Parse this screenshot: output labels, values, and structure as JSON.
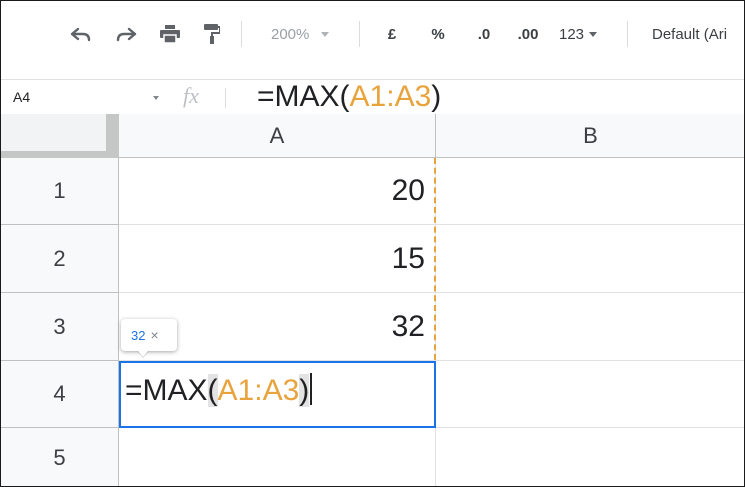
{
  "toolbar": {
    "zoom": "200%",
    "currency": "£",
    "percent": "%",
    "decrease_decimals": ".0",
    "increase_decimals": ".00",
    "more_formats": "123",
    "font": "Default (Ari"
  },
  "formula_bar": {
    "name_box": "A4",
    "fx": "fx",
    "formula_parts": [
      "=MAX",
      "(",
      "A1",
      ":",
      "A3",
      ")"
    ]
  },
  "grid": {
    "columns": [
      "A",
      "B"
    ],
    "rows": [
      "1",
      "2",
      "3",
      "4",
      "5"
    ],
    "values": {
      "A1": "20",
      "A2": "15",
      "A3": "32"
    }
  },
  "editing": {
    "cell": "A4",
    "formula_parts": [
      "=MAX",
      "(",
      "A1",
      ":",
      "A3",
      ")"
    ],
    "preview_value": "32",
    "preview_close": "×"
  },
  "colors": {
    "range_highlight": "#e8a33d",
    "selection": "#1a73e8"
  }
}
